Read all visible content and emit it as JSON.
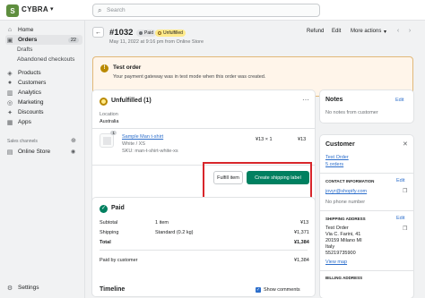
{
  "topbar": {
    "store_name": "CYBRA",
    "search_placeholder": "Search"
  },
  "sidebar": {
    "items": [
      {
        "label": "Home",
        "icon": "home-icon"
      },
      {
        "label": "Orders",
        "icon": "orders-icon",
        "badge": "22",
        "active": true
      },
      {
        "label": "Drafts",
        "sub": true
      },
      {
        "label": "Abandoned checkouts",
        "sub": true
      },
      {
        "label": "Products",
        "icon": "products-icon"
      },
      {
        "label": "Customers",
        "icon": "customers-icon"
      },
      {
        "label": "Analytics",
        "icon": "analytics-icon"
      },
      {
        "label": "Marketing",
        "icon": "marketing-icon"
      },
      {
        "label": "Discounts",
        "icon": "discounts-icon"
      },
      {
        "label": "Apps",
        "icon": "apps-icon"
      }
    ],
    "sales_channels_label": "Sales channels",
    "online_store": "Online Store",
    "settings": "Settings"
  },
  "header": {
    "order_number": "#1032",
    "paid_badge": "Paid",
    "unfulfilled_badge": "Unfulfilled",
    "date_line": "May 11, 2022 at 9:16 pm from Online Store",
    "refund": "Refund",
    "edit": "Edit",
    "more_actions": "More actions"
  },
  "banner": {
    "title": "Test order",
    "body": "Your payment gateway was in test mode when this order was created."
  },
  "fulfillment": {
    "title": "Unfulfilled (1)",
    "location_label": "Location",
    "location": "Australia",
    "item_name": "Sample Man t-shirt",
    "item_variant": "White / XS",
    "item_sku": "SKU: man-t-shirt-white-xs",
    "item_qty": "¥13 × 1",
    "item_total": "¥13",
    "qty_badge": "1",
    "fulfill_button": "Fulfill item",
    "shipping_button": "Create shipping label"
  },
  "payment": {
    "title": "Paid",
    "rows": [
      {
        "label": "Subtotal",
        "detail": "1 item",
        "amount": "¥13"
      },
      {
        "label": "Shipping",
        "detail": "Standard (0.2 kg)",
        "amount": "¥1,371"
      },
      {
        "label": "Total",
        "detail": "",
        "amount": "¥1,384"
      }
    ],
    "paid_by_label": "Paid by customer",
    "paid_by_amount": "¥1,384"
  },
  "timeline": {
    "title": "Timeline",
    "show_comments": "Show comments"
  },
  "notes": {
    "title": "Notes",
    "edit": "Edit",
    "empty": "No notes from customer"
  },
  "customer": {
    "title": "Customer",
    "name": "Test Order",
    "orders": "5 orders",
    "contact_label": "CONTACT INFORMATION",
    "contact_edit": "Edit",
    "email": "jovyr@shopify.com",
    "phone": "No phone number",
    "shipping_label": "SHIPPING ADDRESS",
    "shipping_edit": "Edit",
    "address": [
      "Test Order",
      "Via C. Farini, 41",
      "20159 Milano MI",
      "Italy",
      "55219735900"
    ],
    "view_map": "View map",
    "billing_label": "BILLING ADDRESS"
  },
  "colors": {
    "highlight": "#d8262b",
    "primary_button": "#008060",
    "banner_bg": "#fff5ea",
    "unfulfilled_badge": "#ffea8a",
    "link": "#2c6ecb"
  }
}
